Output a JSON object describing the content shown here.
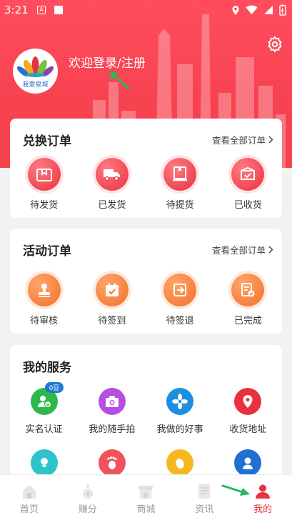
{
  "status_bar": {
    "time": "3:21",
    "a_icon": "A"
  },
  "header": {
    "login_text": "欢迎登录/注册",
    "logo_text": "我爱泉城",
    "settings_icon": "gear-icon"
  },
  "exchange_orders": {
    "title": "兑换订单",
    "link": "查看全部订单",
    "items": [
      {
        "label": "待发货",
        "icon": "box-icon"
      },
      {
        "label": "已发货",
        "icon": "truck-icon"
      },
      {
        "label": "待提货",
        "icon": "package-pickup-icon"
      },
      {
        "label": "已收货",
        "icon": "box-check-icon"
      }
    ]
  },
  "activity_orders": {
    "title": "活动订单",
    "link": "查看全部订单",
    "items": [
      {
        "label": "待审核",
        "icon": "stamp-icon"
      },
      {
        "label": "待签到",
        "icon": "calendar-icon"
      },
      {
        "label": "待签退",
        "icon": "sign-out-icon"
      },
      {
        "label": "已完成",
        "icon": "document-check-icon"
      }
    ]
  },
  "services": {
    "title": "我的服务",
    "badge": "0豆",
    "items": [
      {
        "label": "实名认证",
        "icon": "user-verify-icon",
        "color": "#2db84c"
      },
      {
        "label": "我的随手拍",
        "icon": "camera-icon",
        "color": "#b44fe0"
      },
      {
        "label": "我做的好事",
        "icon": "fan-icon",
        "color": "#1c8fe0"
      },
      {
        "label": "收货地址",
        "icon": "location-pin-icon",
        "color": "#e8323f"
      }
    ],
    "items_row2": [
      {
        "icon": "lightbulb-icon",
        "color": "#2cc4c9"
      },
      {
        "icon": "footprint-icon",
        "color": "#f0525e"
      },
      {
        "icon": "coin-icon",
        "color": "#f5b820"
      },
      {
        "icon": "volunteer-icon",
        "color": "#1f6fd4"
      }
    ]
  },
  "tabbar": [
    {
      "label": "首页",
      "icon": "home-icon"
    },
    {
      "label": "赚分",
      "icon": "money-bag-icon"
    },
    {
      "label": "商城",
      "icon": "shop-icon"
    },
    {
      "label": "资讯",
      "icon": "news-icon"
    },
    {
      "label": "我的",
      "icon": "person-icon",
      "active": true
    }
  ],
  "colors": {
    "brand_red": "#e8323f",
    "header_red": "#f74250",
    "annotation_green": "#27b85a"
  }
}
